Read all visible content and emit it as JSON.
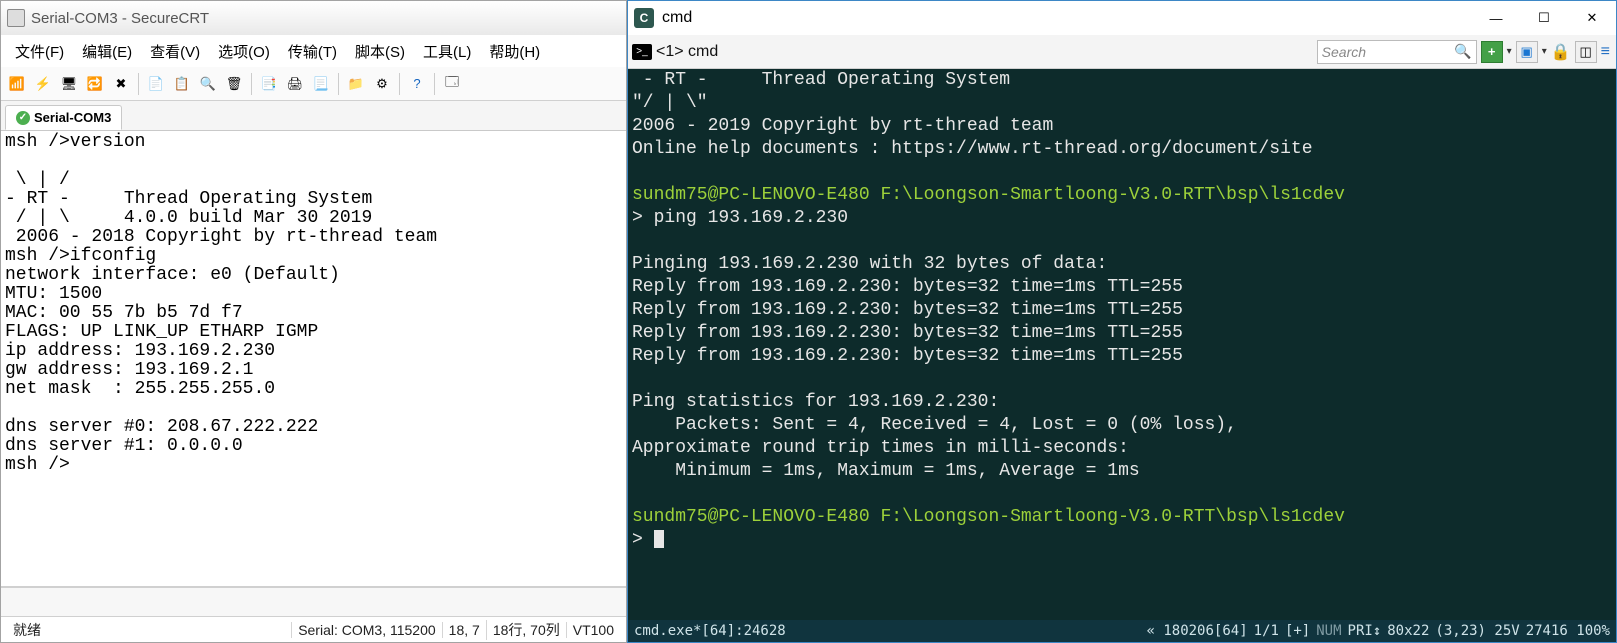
{
  "left": {
    "title": "Serial-COM3 - SecureCRT",
    "menu": [
      "文件(F)",
      "编辑(E)",
      "查看(V)",
      "选项(O)",
      "传输(T)",
      "脚本(S)",
      "工具(L)",
      "帮助(H)"
    ],
    "tab_label": "Serial-COM3",
    "term": "msh />version\n\n \\ | /\n- RT -     Thread Operating System\n / | \\     4.0.0 build Mar 30 2019\n 2006 - 2018 Copyright by rt-thread team\nmsh />ifconfig\nnetwork interface: e0 (Default)\nMTU: 1500\nMAC: 00 55 7b b5 7d f7\nFLAGS: UP LINK_UP ETHARP IGMP\nip address: 193.169.2.230\ngw address: 193.169.2.1\nnet mask  : 255.255.255.0\n\ndns server #0: 208.67.222.222\ndns server #1: 0.0.0.0\nmsh />",
    "status": {
      "ready": "就绪",
      "serial": "Serial: COM3, 115200",
      "rc": "18,  7",
      "pos": "18行, 70列",
      "mode": "VT100"
    }
  },
  "right": {
    "title": "cmd",
    "tab_label": "<1> cmd",
    "search_placeholder": "Search",
    "term_top": " - RT -     Thread Operating System\n\"/ | \\\"\n2006 - 2019 Copyright by rt-thread team\nOnline help documents : https://www.rt-thread.org/document/site\n",
    "prompt1_user": "sundm75@PC-LENOVO-E480 ",
    "prompt1_path": "F:\\Loongson-Smartloong-V3.0-RTT\\bsp\\ls1cdev",
    "cmd1": "> ping 193.169.2.230",
    "ping_body": "\nPinging 193.169.2.230 with 32 bytes of data:\nReply from 193.169.2.230: bytes=32 time=1ms TTL=255\nReply from 193.169.2.230: bytes=32 time=1ms TTL=255\nReply from 193.169.2.230: bytes=32 time=1ms TTL=255\nReply from 193.169.2.230: bytes=32 time=1ms TTL=255\n\nPing statistics for 193.169.2.230:\n    Packets: Sent = 4, Received = 4, Lost = 0 (0% loss),\nApproximate round trip times in milli-seconds:\n    Minimum = 1ms, Maximum = 1ms, Average = 1ms\n",
    "prompt2_user": "sundm75@PC-LENOVO-E480 ",
    "prompt2_path": "F:\\Loongson-Smartloong-V3.0-RTT\\bsp\\ls1cdev",
    "cmd2": "> ",
    "status": {
      "exe": "cmd.exe*[64]:24628",
      "enc": "« 180206[64]",
      "pages": "1/1",
      "plus": "[+]",
      "num": "NUM",
      "pri": "PRI↕",
      "size": "80x22",
      "cursor": "(3,23) 25V",
      "extra": "27416 100%"
    }
  },
  "toolbar_icons": {
    "tb1": "connect",
    "tb2": "quick",
    "tb3": "session",
    "tb4": "reconnect",
    "tb5": "disconnect",
    "tb6": "copy",
    "tb7": "paste",
    "tb8": "find",
    "tb9": "clear",
    "tb10": "print-setup",
    "tb11": "print",
    "tb12": "print-screen",
    "tb13": "transfer",
    "tb14": "options",
    "tb15": "help",
    "tb16": "about"
  }
}
